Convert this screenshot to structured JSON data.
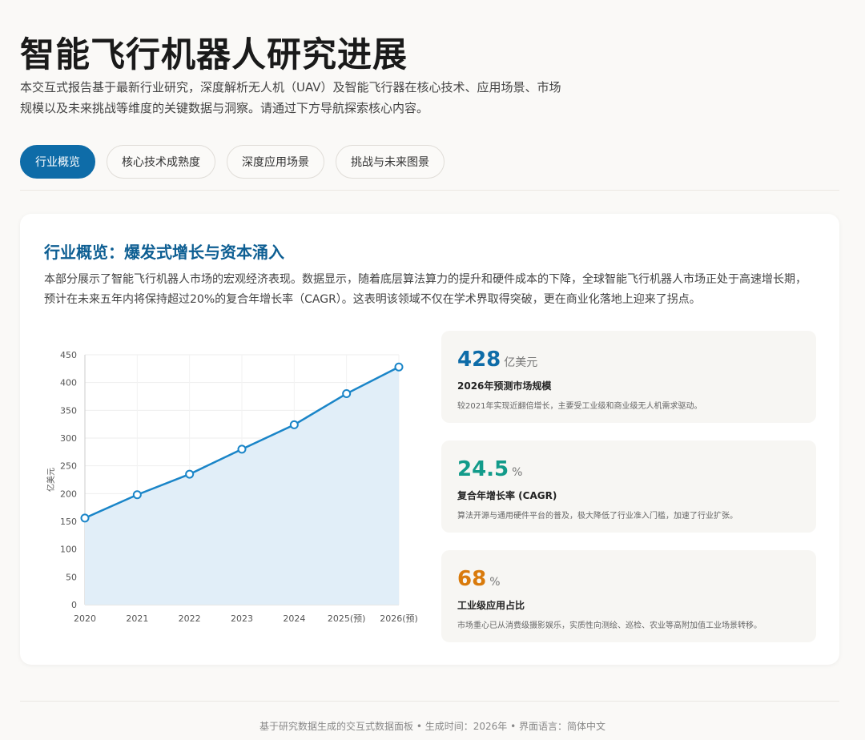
{
  "header": {
    "title": "智能飞行机器人研究进展",
    "intro": "本交互式报告基于最新行业研究，深度解析无人机（UAV）及智能飞行器在核心技术、应用场景、市场规模以及未来挑战等维度的关键数据与洞察。请通过下方导航探索核心内容。"
  },
  "tabs": [
    {
      "label": "行业概览",
      "active": true
    },
    {
      "label": "核心技术成熟度",
      "active": false
    },
    {
      "label": "深度应用场景",
      "active": false
    },
    {
      "label": "挑战与未来图景",
      "active": false
    }
  ],
  "section": {
    "title": "行业概览：爆发式增长与资本涌入",
    "desc": "本部分展示了智能飞行机器人市场的宏观经济表现。数据显示，随着底层算法算力的提升和硬件成本的下降，全球智能飞行机器人市场正处于高速增长期，预计在未来五年内将保持超过20%的复合年增长率（CAGR）。这表明该领域不仅在学术界取得突破，更在商业化落地上迎来了拐点。"
  },
  "chart_data": {
    "type": "area",
    "categories": [
      "2020",
      "2021",
      "2022",
      "2023",
      "2024",
      "2025(预)",
      "2026(预)"
    ],
    "values": [
      156,
      198,
      235,
      280,
      324,
      380,
      428
    ],
    "ylabel": "亿美元",
    "ylim": [
      0,
      450
    ],
    "yticks": [
      0,
      50,
      100,
      150,
      200,
      250,
      300,
      350,
      400,
      450
    ],
    "grid": true,
    "line_color": "#1a85c8",
    "fill_color": "#e1eef8"
  },
  "stats": [
    {
      "value": "428",
      "unit": "亿美元",
      "label": "2026年预测市场规模",
      "desc": "较2021年实现近翻倍增长，主要受工业级和商业级无人机需求驱动。",
      "color": "#0e6ca8"
    },
    {
      "value": "24.5",
      "unit": "%",
      "label": "复合年增长率 (CAGR)",
      "desc": "算法开源与通用硬件平台的普及，极大降低了行业准入门槛，加速了行业扩张。",
      "color": "#129b8a"
    },
    {
      "value": "68",
      "unit": "%",
      "label": "工业级应用占比",
      "desc": "市场重心已从消费级摄影娱乐，实质性向测绘、巡检、农业等高附加值工业场景转移。",
      "color": "#d97a0b"
    }
  ],
  "footer": "基于研究数据生成的交互式数据面板 • 生成时间：2026年 • 界面语言：简体中文"
}
